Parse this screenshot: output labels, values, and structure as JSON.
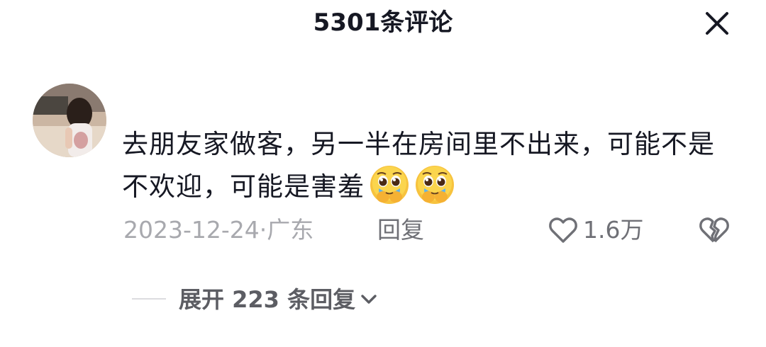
{
  "header": {
    "title": "5301条评论",
    "close_icon": "close-icon"
  },
  "comment": {
    "avatar_icon": "user-avatar",
    "text": "去朋友家做客，另一半在房间里不出来，可能不是不欢迎，可能是害羞",
    "emojis": [
      "pleading-face-emoji",
      "pleading-face-emoji"
    ],
    "date": "2023-12-24",
    "separator": "·",
    "location": "广东",
    "reply_label": "回复",
    "like_icon": "heart-icon",
    "like_count": "1.6万",
    "dislike_icon": "broken-heart-icon"
  },
  "replies": {
    "expand_label": "展开 223 条回复",
    "chevron_icon": "chevron-down-icon"
  },
  "colors": {
    "text_primary": "#161823",
    "text_secondary": "#a8a9ae",
    "text_action": "#6f7076",
    "divider": "#dcdcdf"
  }
}
